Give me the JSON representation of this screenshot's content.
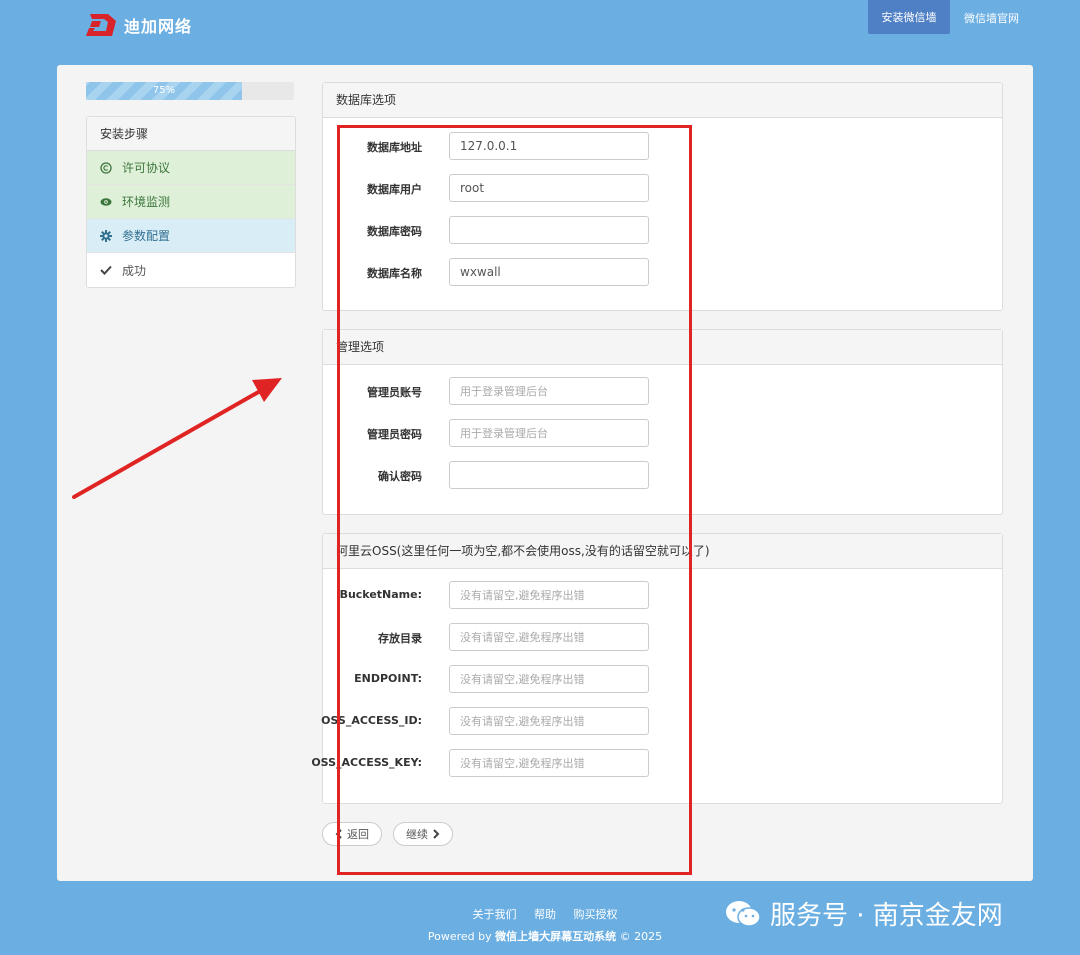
{
  "brand": {
    "name": "迪加网络"
  },
  "nav": {
    "install": "安装微信墙",
    "site": "微信墙官网"
  },
  "progress": {
    "label": "75%",
    "value": 0.75
  },
  "steps": {
    "header": "安装步骤",
    "items": [
      {
        "label": "许可协议",
        "icon": "copyright-icon",
        "state": "done"
      },
      {
        "label": "环境监测",
        "icon": "eye-icon",
        "state": "done"
      },
      {
        "label": "参数配置",
        "icon": "gear-icon",
        "state": "active"
      },
      {
        "label": "成功",
        "icon": "check-icon",
        "state": "todo"
      }
    ]
  },
  "db": {
    "title": "数据库选项",
    "fields": [
      {
        "label": "数据库地址",
        "value": "127.0.0.1",
        "placeholder": ""
      },
      {
        "label": "数据库用户",
        "value": "root",
        "placeholder": ""
      },
      {
        "label": "数据库密码",
        "value": "",
        "placeholder": ""
      },
      {
        "label": "数据库名称",
        "value": "wxwall",
        "placeholder": ""
      }
    ]
  },
  "admin": {
    "title": "管理选项",
    "fields": [
      {
        "label": "管理员账号",
        "value": "",
        "placeholder": "用于登录管理后台"
      },
      {
        "label": "管理员密码",
        "value": "",
        "placeholder": "用于登录管理后台"
      },
      {
        "label": "确认密码",
        "value": "",
        "placeholder": ""
      }
    ]
  },
  "oss": {
    "title": "阿里云OSS(这里任何一项为空,都不会使用oss,没有的话留空就可以了)",
    "fields": [
      {
        "label": "BucketName:",
        "value": "",
        "placeholder": "没有请留空,避免程序出错"
      },
      {
        "label": "存放目录",
        "value": "",
        "placeholder": "没有请留空,避免程序出错"
      },
      {
        "label": "ENDPOINT:",
        "value": "",
        "placeholder": "没有请留空,避免程序出错"
      },
      {
        "label": "OSS_ACCESS_ID:",
        "value": "",
        "placeholder": "没有请留空,避免程序出错"
      },
      {
        "label": "OSS_ACCESS_KEY:",
        "value": "",
        "placeholder": "没有请留空,避免程序出错"
      }
    ]
  },
  "buttons": {
    "back": "返回",
    "next": "继续"
  },
  "footer": {
    "links": [
      "关于我们",
      "帮助",
      "购买授权"
    ],
    "powered_prefix": "Powered by ",
    "powered_name": "微信上墙大屏幕互动系统",
    "powered_suffix": " © 2025"
  },
  "watermark": {
    "text": "服务号 · 南京金友网"
  },
  "colors": {
    "background": "#6aaee2",
    "accent": "#4f7fc4",
    "annotation": "#e02424"
  }
}
